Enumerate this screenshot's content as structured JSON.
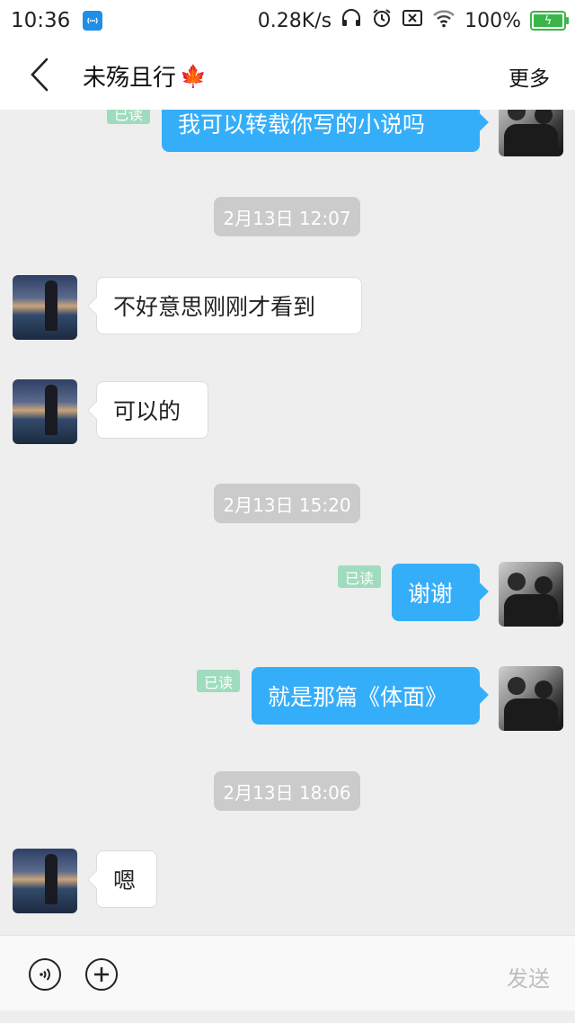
{
  "status_bar": {
    "time": "10:36",
    "network_speed": "0.28K/s",
    "battery": "100%",
    "icons": [
      "wifi-hotspot-icon",
      "headphones-icon",
      "alarm-icon",
      "sim-icon",
      "wifi-icon",
      "battery-icon"
    ]
  },
  "header": {
    "title": "未殇且行",
    "title_emoji": "🍁",
    "more_label": "更多"
  },
  "messages": [
    {
      "side": "right",
      "text": "我可以转载你写的小说吗",
      "read_label": "已读"
    },
    {
      "type": "timestamp",
      "text": "2月13日 12:07"
    },
    {
      "side": "left",
      "text": "不好意思刚刚才看到"
    },
    {
      "side": "left",
      "text": "可以的"
    },
    {
      "type": "timestamp",
      "text": "2月13日 15:20"
    },
    {
      "side": "right",
      "text": "谢谢",
      "read_label": "已读"
    },
    {
      "side": "right",
      "text": "就是那篇《体面》",
      "read_label": "已读"
    },
    {
      "type": "timestamp",
      "text": "2月13日 18:06"
    },
    {
      "side": "left",
      "text": "嗯"
    }
  ],
  "input_bar": {
    "send_label": "发送"
  },
  "colors": {
    "outgoing_bubble": "#35aef9",
    "incoming_bubble": "#ffffff",
    "read_badge": "#9fdcbd",
    "timestamp_bg": "#cbcbcb",
    "background": "#eeeeee"
  }
}
